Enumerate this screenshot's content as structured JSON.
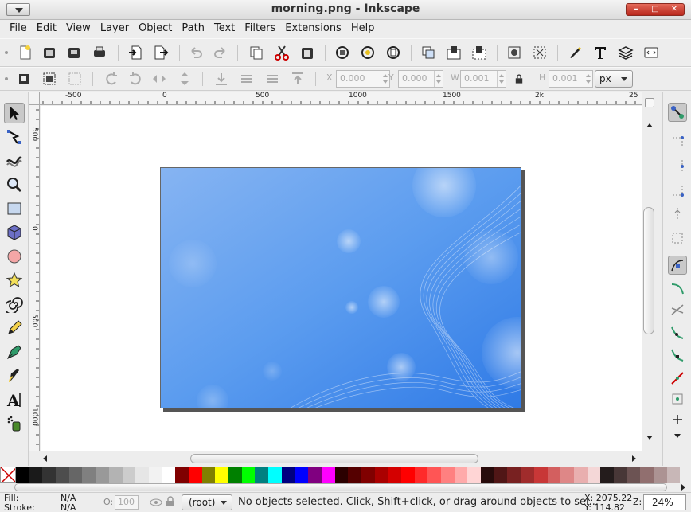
{
  "window": {
    "title": "morning.png - Inkscape",
    "controls": [
      "–",
      "□",
      "✕"
    ]
  },
  "menu": [
    "File",
    "Edit",
    "View",
    "Layer",
    "Object",
    "Path",
    "Text",
    "Filters",
    "Extensions",
    "Help"
  ],
  "command_bar": {
    "icons": [
      "new-document-icon",
      "open-icon",
      "save-icon",
      "print-icon",
      "import-icon",
      "export-icon",
      "undo-icon",
      "redo-icon",
      "copy-icon",
      "cut-icon",
      "paste-icon",
      "zoom-selection-icon",
      "zoom-drawing-icon",
      "zoom-page-icon",
      "duplicate-icon",
      "group-icon",
      "ungroup-icon",
      "fill-stroke-icon",
      "align-icon",
      "xml-editor-icon",
      "text-font-icon",
      "layers-icon",
      "preferences-icon"
    ]
  },
  "controls_bar": {
    "x_label": "X",
    "x_value": "0.000",
    "y_label": "Y",
    "y_value": "0.000",
    "w_label": "W",
    "w_value": "0.001",
    "h_label": "H",
    "h_value": "0.001",
    "unit": "px"
  },
  "rulers": {
    "horizontal": [
      "-500",
      "0",
      "500",
      "1000",
      "1500",
      "2k",
      "25"
    ],
    "vertical": [
      "500",
      "0",
      "500",
      "1000"
    ]
  },
  "tools": [
    "selector-tool",
    "node-tool",
    "tweak-tool",
    "zoom-tool",
    "rectangle-tool",
    "3dbox-tool",
    "ellipse-tool",
    "star-tool",
    "spiral-tool",
    "pencil-tool",
    "pen-tool",
    "calligraphy-tool",
    "text-tool",
    "spray-tool"
  ],
  "palette": {
    "colors": [
      "#000000",
      "#1a1a1a",
      "#333333",
      "#4d4d4d",
      "#666666",
      "#808080",
      "#999999",
      "#b3b3b3",
      "#cccccc",
      "#e6e6e6",
      "#f2f2f2",
      "#ffffff",
      "#800000",
      "#ff0000",
      "#808000",
      "#ffff00",
      "#008000",
      "#00ff00",
      "#008080",
      "#00ffff",
      "#000080",
      "#0000ff",
      "#800080",
      "#ff00ff",
      "#2b0000",
      "#550000",
      "#800000",
      "#aa0000",
      "#d40000",
      "#ff0000",
      "#ff2a2a",
      "#ff5555",
      "#ff8080",
      "#ffaaaa",
      "#ffd5d5",
      "#280b0b",
      "#501616",
      "#782121",
      "#a02c2c",
      "#c83737",
      "#d35f5f",
      "#de8787",
      "#e9afaf",
      "#f4d7d7",
      "#241c1c",
      "#483737",
      "#6c5353",
      "#916f6f",
      "#ac9393",
      "#c8b7b7"
    ]
  },
  "status": {
    "fill_label": "Fill:",
    "fill_value": "N/A",
    "stroke_label": "Stroke:",
    "stroke_value": "N/A",
    "opacity_label": "O:",
    "opacity_value": "100",
    "layer": "(root)",
    "message": "No objects selected. Click, Shift+click, or drag around objects to sel...",
    "x_coord": "X: 2075.22",
    "y_coord": "Y:  114.82",
    "zoom_label": "Z:",
    "zoom_value": "24%"
  }
}
